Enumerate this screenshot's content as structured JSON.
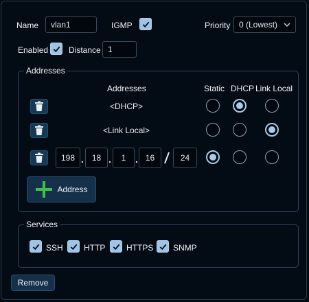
{
  "general": {
    "name_label": "Name",
    "name_value": "vlan1",
    "igmp_label": "IGMP",
    "igmp_checked": true,
    "priority_label": "Priority",
    "priority_value": "0 (Lowest)",
    "enabled_label": "Enabled",
    "enabled_checked": true,
    "distance_label": "Distance",
    "distance_value": "1"
  },
  "addresses": {
    "group_title": "Addresses",
    "column_address": "Addresses",
    "column_static": "Static",
    "column_dhcp": "DHCP",
    "column_link_local": "Link Local",
    "rows": [
      {
        "label": "<DHCP>",
        "selected": "dhcp"
      },
      {
        "label": "<Link Local>",
        "selected": "link_local"
      },
      {
        "octets": [
          "198",
          "18",
          "1",
          "16"
        ],
        "prefix": "24",
        "selected": "static"
      }
    ],
    "add_label": "Address"
  },
  "services": {
    "group_title": "Services",
    "items": [
      {
        "label": "SSH",
        "checked": true
      },
      {
        "label": "HTTP",
        "checked": true
      },
      {
        "label": "HTTPS",
        "checked": true
      },
      {
        "label": "SNMP",
        "checked": true
      }
    ]
  },
  "actions": {
    "remove_label": "Remove"
  },
  "colors": {
    "background": "#030b14",
    "accent": "#a9cbea",
    "button": "#14304a",
    "plus_icon": "#3fbf4a"
  }
}
